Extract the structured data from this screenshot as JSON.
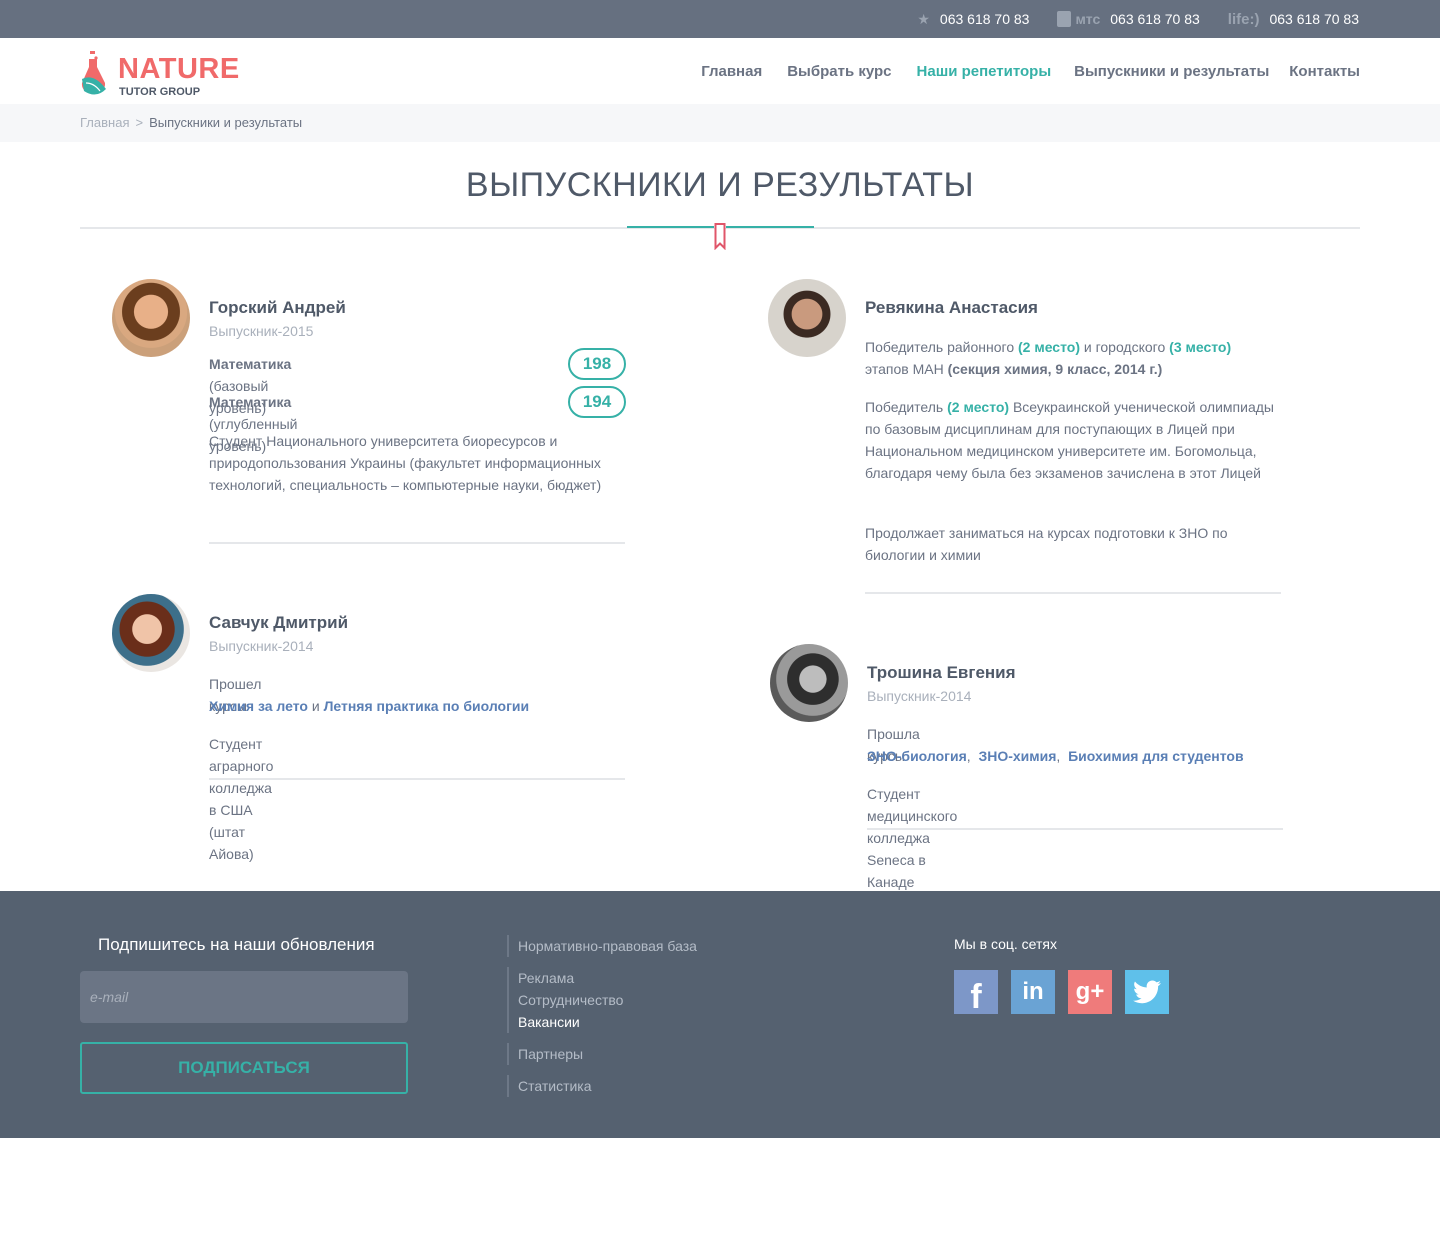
{
  "topbar": {
    "phones": [
      {
        "operator": "★",
        "number": "063 618 70 83"
      },
      {
        "operator": "мтс",
        "number": "063 618 70 83"
      },
      {
        "operator": "life:)",
        "number": "063 618 70 83"
      }
    ]
  },
  "logo": {
    "title": "NATURE",
    "subtitle": "TUTOR GROUP"
  },
  "nav": {
    "items": [
      "Главная",
      "Выбрать курс",
      "Наши репетиторы",
      "Выпускники и результаты",
      "Контакты"
    ],
    "active_index": 2
  },
  "breadcrumb": {
    "home": "Главная",
    "separator": ">",
    "current": "Выпускники и результаты"
  },
  "page": {
    "title": "ВЫПУСКНИКИ И РЕЗУЛЬТАТЫ"
  },
  "graduates": [
    {
      "name": "Горский Андрей",
      "year": "Выпускник-2015",
      "scores": [
        {
          "subject": "Математика",
          "level": "(базовый уровень)",
          "value": "198"
        },
        {
          "subject": "Математика",
          "level": "(углубленный уровень)",
          "value": "194"
        }
      ],
      "text": "Студент Национального университета биоресурсов и природопользования Украины (факультет информационных технологий, специальность – компьютерные науки, бюджет)"
    },
    {
      "name": "Ревякина Анастасия",
      "p1": {
        "a": "Победитель районного ",
        "b": "(2 место)",
        "c": " и городского ",
        "d": "(3 место)",
        "e": " этапов МАН ",
        "f": "(секция химия, 9 класс, 2014 г.)"
      },
      "p2": {
        "a": "Победитель ",
        "b": "(2 место)",
        "c": " Всеукраинской ученической олимпиады по базовым дисциплинам для поступающих в Лицей при Национальном медицинском университете им. Богомольца, благодаря чему была без экзаменов зачислена в этот Лицей"
      },
      "p3": "Продолжает заниматься на курсах подготовки к ЗНО по биологии и химии"
    },
    {
      "name": "Савчук Дмитрий",
      "year": "Выпускник-2014",
      "courses_intro": "Прошел курсы",
      "courses": [
        "Химия за лето",
        "Летняя практика по биологии"
      ],
      "joiner": " и ",
      "text": "Студент аграрного колледжа в США (штат Айова)"
    },
    {
      "name": "Трошина Евгения",
      "year": "Выпускник-2014",
      "courses_intro": "Прошла курсы",
      "courses": [
        "ЗНО-биология",
        "ЗНО-химия",
        "Биохимия для студентов"
      ],
      "joiner": ",  ",
      "text": "Студент медицинского колледжа Seneca в Канаде"
    }
  ],
  "footer": {
    "subscribe_title": "Подпишитесь на наши обновления",
    "email_placeholder": "e-mail",
    "subscribe_button": "ПОДПИСАТЬСЯ",
    "link_groups": [
      [
        "Нормативно-правовая база"
      ],
      [
        "Реклама",
        "Сотрудничество",
        "Вакансии"
      ],
      [
        "Партнеры"
      ],
      [
        "Статистика"
      ]
    ],
    "social_title": "Мы в соц. сетях",
    "socials": [
      {
        "name": "facebook",
        "glyph": "f",
        "color": "#7d97c8"
      },
      {
        "name": "linkedin",
        "glyph": "in",
        "color": "#6aa3d4"
      },
      {
        "name": "google-plus",
        "glyph": "g+",
        "color": "#ef7b7b"
      },
      {
        "name": "twitter",
        "glyph": "t",
        "color": "#5fc0ea"
      }
    ]
  }
}
